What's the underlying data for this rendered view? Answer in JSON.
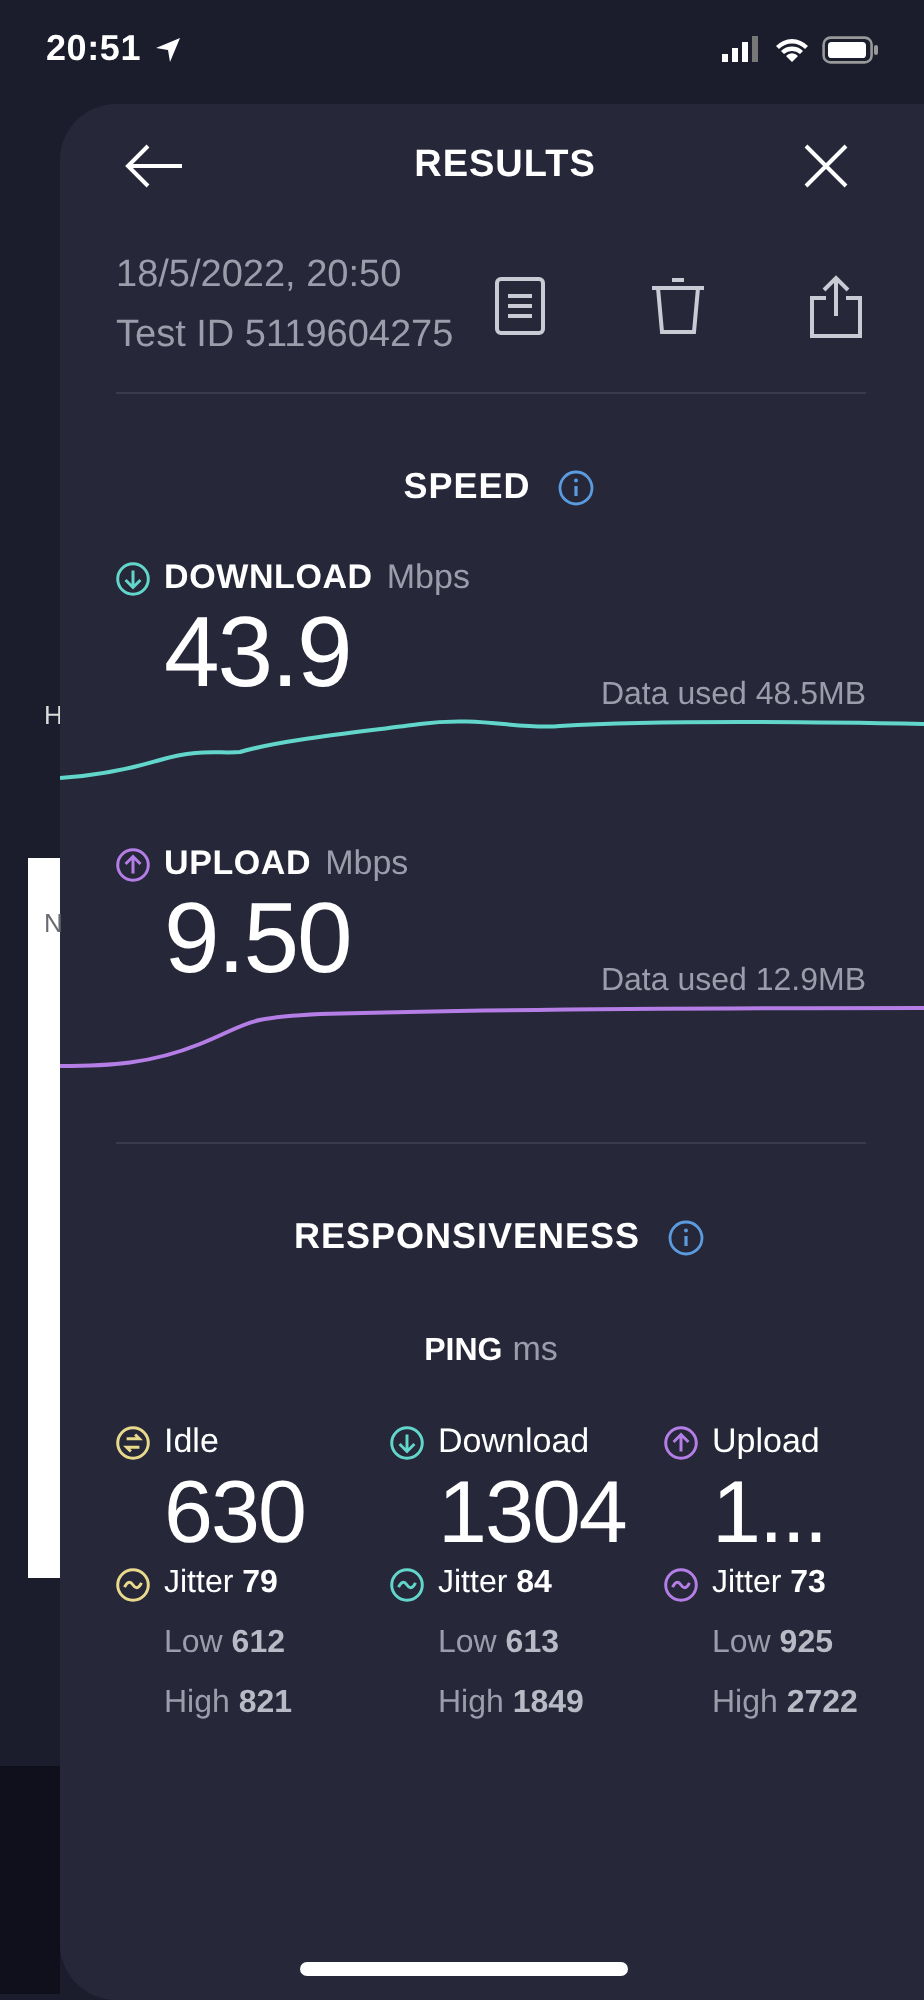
{
  "status_bar": {
    "time": "20:51"
  },
  "background": {
    "fragments": [
      "H",
      "N"
    ]
  },
  "header": {
    "title": "RESULTS"
  },
  "test": {
    "date": "18/5/2022, 20:50",
    "test_id": "Test ID 5119604275"
  },
  "speed": {
    "title": "SPEED",
    "metrics": [
      {
        "kind": "download",
        "label": "DOWNLOAD",
        "unit": "Mbps",
        "value": "43.9",
        "data_used": "Data used 48.5MB",
        "color": "#62d6cb"
      },
      {
        "kind": "upload",
        "label": "UPLOAD",
        "unit": "Mbps",
        "value": "9.50",
        "data_used": "Data used 12.9MB",
        "color": "#b57ee6"
      }
    ]
  },
  "responsiveness": {
    "title": "RESPONSIVENESS",
    "ping": {
      "label": "PING",
      "unit": "ms"
    },
    "columns": [
      {
        "kind": "idle",
        "label": "Idle",
        "value": "630",
        "jitter_label": "Jitter",
        "jitter": "79",
        "low_label": "Low",
        "low": "612",
        "high_label": "High",
        "high": "821",
        "color": "#e8d98c"
      },
      {
        "kind": "download",
        "label": "Download",
        "value": "1304",
        "jitter_label": "Jitter",
        "jitter": "84",
        "low_label": "Low",
        "low": "613",
        "high_label": "High",
        "high": "1849",
        "color": "#62d6cb"
      },
      {
        "kind": "upload",
        "label": "Upload",
        "value": "1...",
        "jitter_label": "Jitter",
        "jitter": "73",
        "low_label": "Low",
        "low": "925",
        "high_label": "High",
        "high": "2722",
        "color": "#b57ee6"
      }
    ]
  }
}
